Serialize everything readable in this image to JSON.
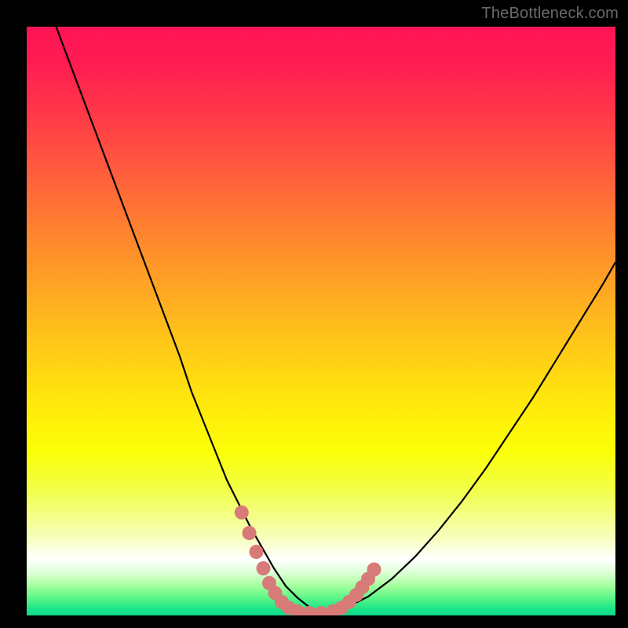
{
  "watermark": "TheBottleneck.com",
  "chart_data": {
    "type": "line",
    "title": "",
    "xlabel": "",
    "ylabel": "",
    "xlim": [
      0,
      100
    ],
    "ylim": [
      0,
      100
    ],
    "series": [
      {
        "name": "bottleneck-curve",
        "x": [
          5,
          8,
          11,
          14,
          17,
          20,
          23,
          26,
          28,
          30,
          32,
          34,
          36,
          38,
          40,
          42,
          44,
          46,
          48,
          50,
          54,
          58,
          62,
          66,
          70,
          74,
          78,
          82,
          86,
          90,
          94,
          98,
          100
        ],
        "y": [
          100,
          92,
          84,
          76,
          68,
          60,
          52,
          44,
          38,
          33,
          28,
          23,
          19,
          15,
          11.5,
          8,
          5,
          3,
          1.4,
          0.5,
          1.2,
          3.2,
          6.2,
          10,
          14.5,
          19.5,
          25,
          31,
          37,
          43.5,
          50,
          56.5,
          60
        ]
      }
    ],
    "markers": {
      "name": "highlight-points",
      "color": "#d87a77",
      "radius_px": 9,
      "points": [
        {
          "x": 36.5,
          "y": 17.5
        },
        {
          "x": 37.8,
          "y": 14.0
        },
        {
          "x": 39.0,
          "y": 10.8
        },
        {
          "x": 40.2,
          "y": 8.0
        },
        {
          "x": 41.2,
          "y": 5.5
        },
        {
          "x": 42.2,
          "y": 3.8
        },
        {
          "x": 43.3,
          "y": 2.3
        },
        {
          "x": 44.5,
          "y": 1.3
        },
        {
          "x": 46.0,
          "y": 0.7
        },
        {
          "x": 48.0,
          "y": 0.4
        },
        {
          "x": 50.0,
          "y": 0.4
        },
        {
          "x": 52.0,
          "y": 0.7
        },
        {
          "x": 53.5,
          "y": 1.3
        },
        {
          "x": 54.8,
          "y": 2.3
        },
        {
          "x": 56.0,
          "y": 3.5
        },
        {
          "x": 57.0,
          "y": 4.8
        },
        {
          "x": 58.0,
          "y": 6.2
        },
        {
          "x": 59.0,
          "y": 7.8
        }
      ]
    },
    "background": {
      "type": "vertical-gradient",
      "stops": [
        {
          "pos": 0.0,
          "color": "#ff1455"
        },
        {
          "pos": 0.5,
          "color": "#ffc818"
        },
        {
          "pos": 0.9,
          "color": "#ffffff"
        },
        {
          "pos": 1.0,
          "color": "#0fd789"
        }
      ]
    }
  }
}
